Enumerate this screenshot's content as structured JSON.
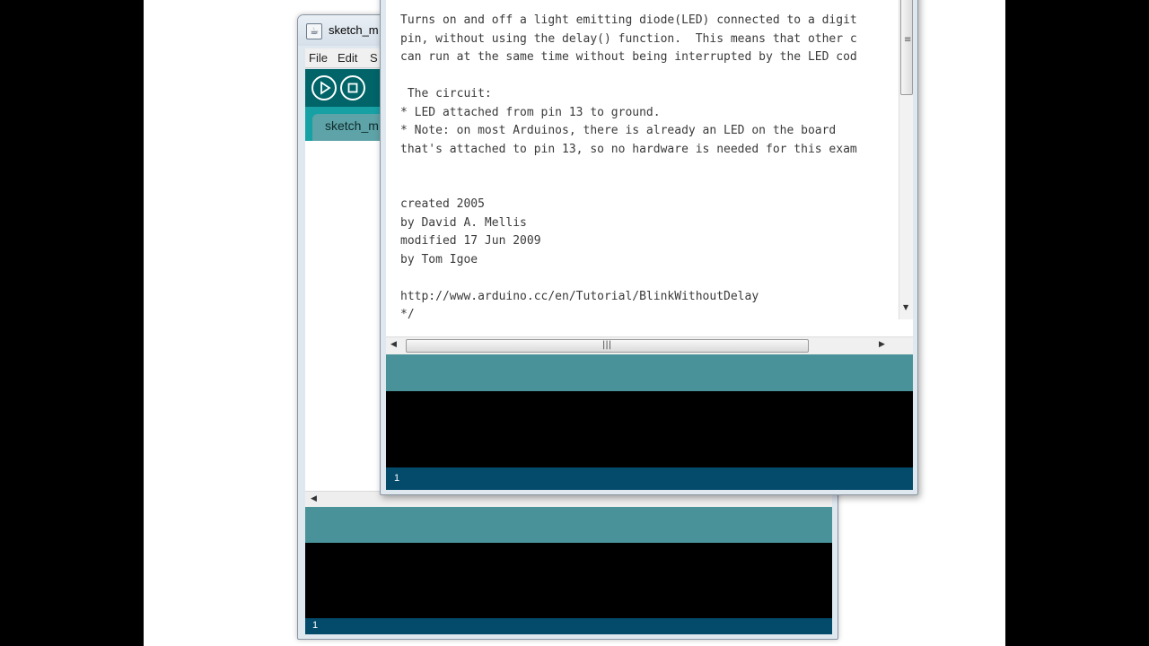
{
  "back_window": {
    "title": "sketch_m",
    "menu": [
      "File",
      "Edit",
      "S"
    ],
    "toolbar": {
      "verify_icon": "play-icon",
      "stop_icon": "stop-icon"
    },
    "tab_label": "sketch_m",
    "line_number": "1"
  },
  "front_window": {
    "code_lines": [
      "Turns on and off a light emitting diode(LED) connected to a digit",
      "pin, without using the delay() function.  This means that other c",
      "can run at the same time without being interrupted by the LED cod",
      "",
      " The circuit:",
      "* LED attached from pin 13 to ground.",
      "* Note: on most Arduinos, there is already an LED on the board",
      "that's attached to pin 13, so no hardware is needed for this exam",
      "",
      "",
      "created 2005",
      "by David A. Mellis",
      "modified 17 Jun 2009",
      "by Tom Igoe",
      "",
      "http://www.arduino.cc/en/Tutorial/BlinkWithoutDelay",
      "*/"
    ],
    "line_number": "1"
  },
  "colors": {
    "toolbar": "#006468",
    "tabbar": "#17a1a5",
    "status": "#4a9299",
    "console": "#000000",
    "lineline": "#034a6b"
  }
}
